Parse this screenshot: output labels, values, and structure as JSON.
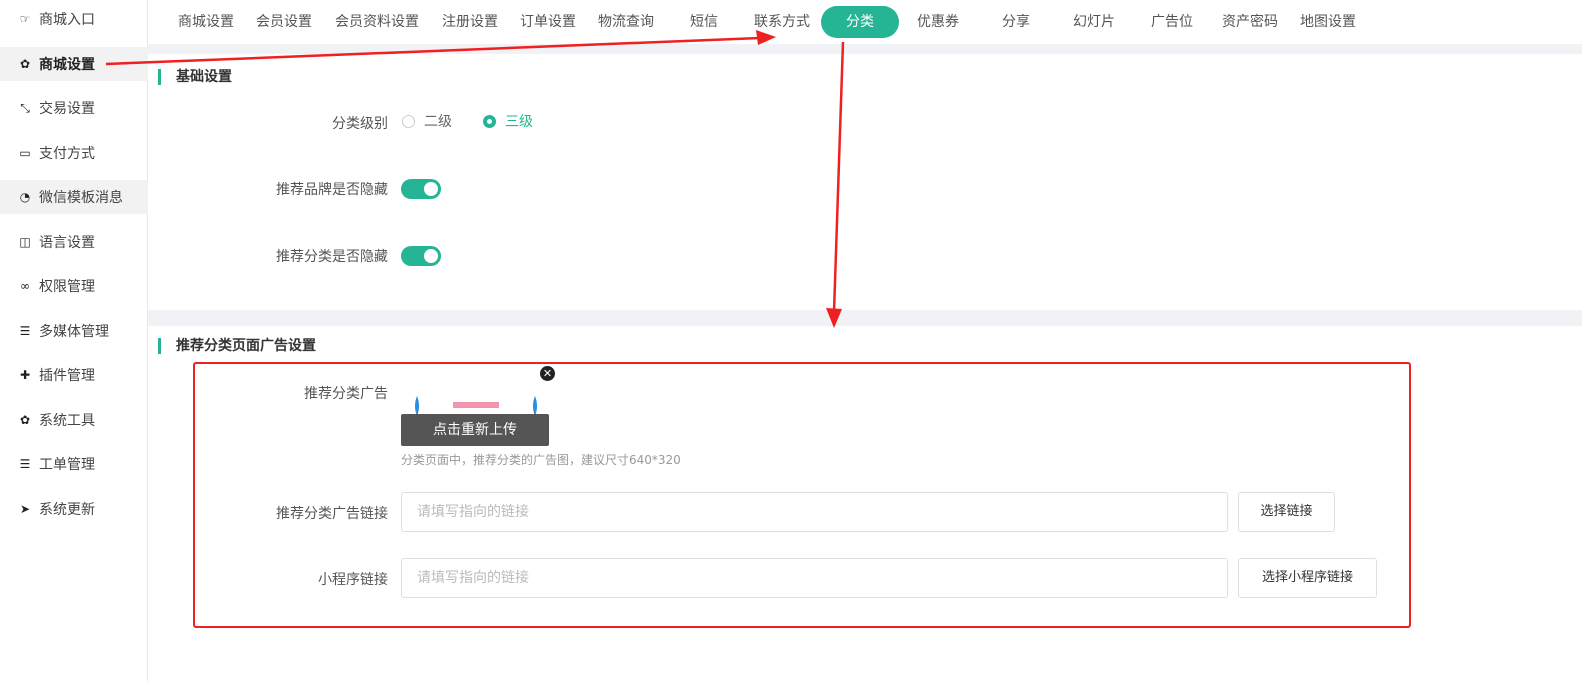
{
  "sidebar": {
    "items": [
      {
        "label": "商城入口",
        "icon": "hand-point-icon",
        "glyph": "☞"
      },
      {
        "label": "商城设置",
        "icon": "gear-icon",
        "glyph": "✿"
      },
      {
        "label": "交易设置",
        "icon": "compress-arrows-icon",
        "glyph": "⤡"
      },
      {
        "label": "支付方式",
        "icon": "credit-card-icon",
        "glyph": "▭"
      },
      {
        "label": "微信模板消息",
        "icon": "wechat-icon",
        "glyph": "◔"
      },
      {
        "label": "语言设置",
        "icon": "language-icon",
        "glyph": "◫"
      },
      {
        "label": "权限管理",
        "icon": "mask-icon",
        "glyph": "∞"
      },
      {
        "label": "多媒体管理",
        "icon": "list-icon",
        "glyph": "☰"
      },
      {
        "label": "插件管理",
        "icon": "puzzle-icon",
        "glyph": "✚"
      },
      {
        "label": "系统工具",
        "icon": "cog-icon",
        "glyph": "✿"
      },
      {
        "label": "工单管理",
        "icon": "list-icon",
        "glyph": "☰"
      },
      {
        "label": "系统更新",
        "icon": "paper-plane-icon",
        "glyph": "➤"
      }
    ]
  },
  "tabs": [
    "商城设置",
    "会员设置",
    "会员资料设置",
    "注册设置",
    "订单设置",
    "物流查询",
    "短信",
    "联系方式",
    "分类",
    "优惠券",
    "分享",
    "幻灯片",
    "广告位",
    "资产密码",
    "地图设置"
  ],
  "active_tab": "分类",
  "basic": {
    "title": "基础设置",
    "category_level_label": "分类级别",
    "level_options": [
      "二级",
      "三级"
    ],
    "selected_level": "三级",
    "hide_brand_label": "推荐品牌是否隐藏",
    "hide_brand": true,
    "hide_category_label": "推荐分类是否隐藏",
    "hide_category": true
  },
  "ad": {
    "title": "推荐分类页面广告设置",
    "ad_label": "推荐分类广告",
    "reupload_label": "点击重新上传",
    "hint": "分类页面中，推荐分类的广告图，建议尺寸640*320",
    "link_label": "推荐分类广告链接",
    "link_placeholder": "请填写指向的链接",
    "link_value": "",
    "choose_link_label": "选择链接",
    "mp_label": "小程序链接",
    "mp_placeholder": "请填写指向的链接",
    "mp_value": "",
    "choose_mp_label": "选择小程序链接"
  },
  "colors": {
    "accent": "#26b594",
    "annotation": "#ee2020"
  }
}
